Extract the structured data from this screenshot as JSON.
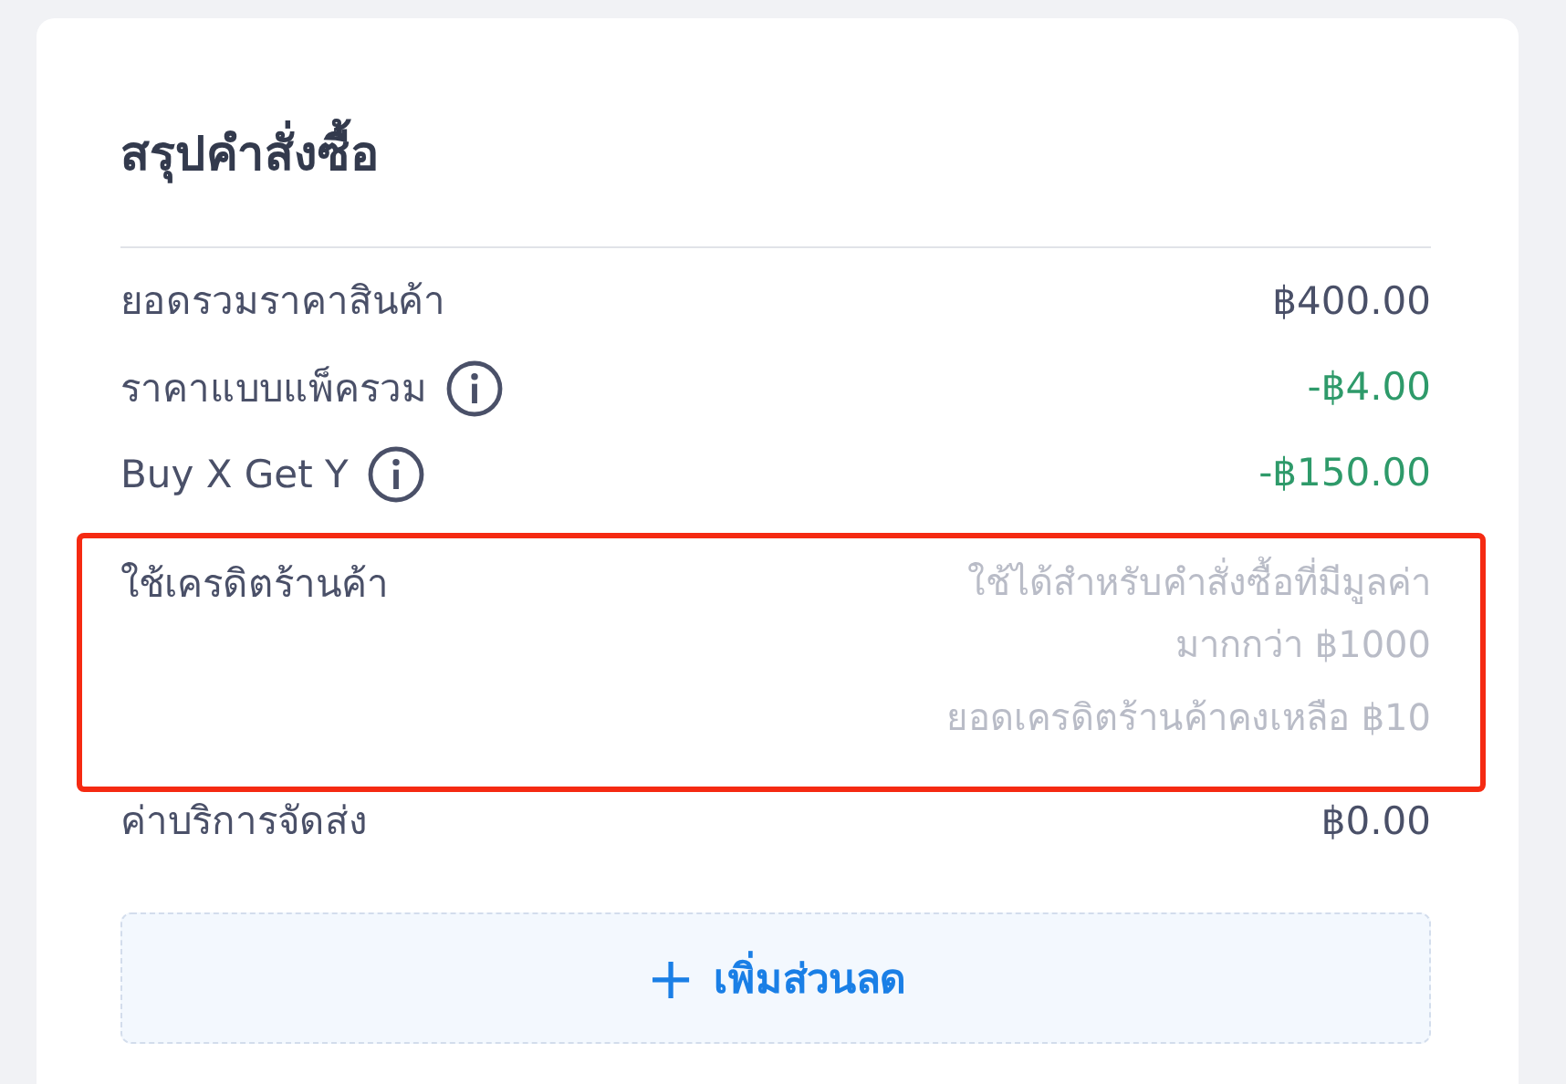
{
  "title": "สรุปคำสั่งซื้อ",
  "rows": [
    {
      "label": "ยอดรวมราคาสินค้า",
      "info": false,
      "highlighted": false,
      "kind": "amount",
      "value": "฿400.00",
      "discount": false
    },
    {
      "label": "ราคาแบบแพ็ครวม",
      "info": true,
      "highlighted": false,
      "kind": "amount",
      "value": "-฿4.00",
      "discount": true
    },
    {
      "label": "Buy X Get Y",
      "info": true,
      "highlighted": false,
      "kind": "amount",
      "value": "-฿150.00",
      "discount": true
    },
    {
      "label": "ใช้เครดิตร้านค้า",
      "info": false,
      "highlighted": true,
      "kind": "note",
      "notes": [
        "ใช้ได้สำหรับคำสั่งซื้อที่มีมูลค่า",
        "มากกว่า ฿1000",
        "ยอดเครดิตร้านค้าคงเหลือ ฿10"
      ]
    },
    {
      "label": "ค่าบริการจัดส่ง",
      "info": false,
      "highlighted": false,
      "kind": "amount",
      "value": "฿0.00",
      "discount": false
    }
  ],
  "add_button": {
    "icon": "+",
    "label": "เพิ่มส่วนลด"
  }
}
